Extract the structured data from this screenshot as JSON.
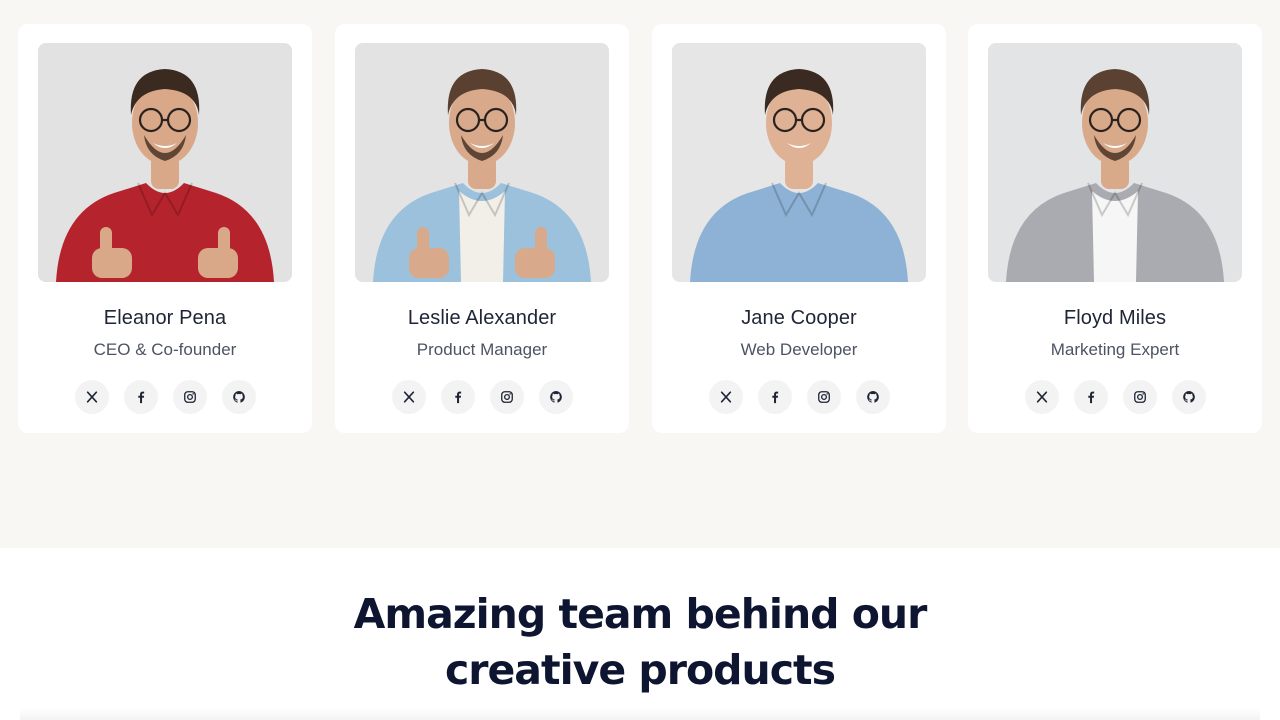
{
  "team": [
    {
      "name": "Eleanor Pena",
      "role": "CEO & Co-founder",
      "photo": {
        "background": "#e2e2e2",
        "shirt": "#b5232c",
        "undershirt": "#b5232c",
        "skin": "#d9a888",
        "hair": "#3b2a20"
      }
    },
    {
      "name": "Leslie Alexander",
      "role": "Product Manager",
      "photo": {
        "background": "#e3e3e3",
        "shirt": "#9cc1dc",
        "undershirt": "#f2efe8",
        "skin": "#d8a98a",
        "hair": "#5a4030"
      }
    },
    {
      "name": "Jane Cooper",
      "role": "Web Developer",
      "photo": {
        "background": "#e6e6e6",
        "shirt": "#8db2d6",
        "undershirt": "#8db2d6",
        "skin": "#e0b295",
        "hair": "#3a2a22"
      }
    },
    {
      "name": "Floyd Miles",
      "role": "Marketing Expert",
      "photo": {
        "background": "#e2e4e6",
        "shirt": "#a9abb0",
        "undershirt": "#f6f6f6",
        "skin": "#d9aa8a",
        "hair": "#5b4131"
      }
    }
  ],
  "socials": [
    "x-icon",
    "facebook-icon",
    "instagram-icon",
    "github-icon"
  ],
  "headline": {
    "line1": "Amazing team behind our",
    "line2": "creative products"
  },
  "colors": {
    "section_bg": "#f8f7f4",
    "card_bg": "#ffffff",
    "heading": "#0d1530",
    "name": "#1f2536",
    "role": "#4d5363"
  }
}
